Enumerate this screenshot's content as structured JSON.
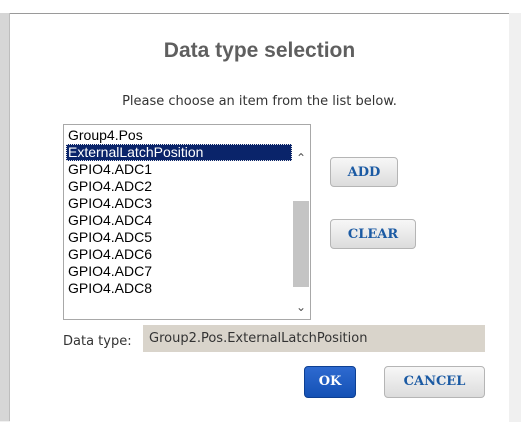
{
  "dialog": {
    "title": "Data type selection",
    "instruction": "Please choose an item from the list below."
  },
  "list": {
    "items": [
      "Group4.Pos",
      "ExternalLatchPosition",
      "GPIO4.ADC1",
      "GPIO4.ADC2",
      "GPIO4.ADC3",
      "GPIO4.ADC4",
      "GPIO4.ADC5",
      "GPIO4.ADC6",
      "GPIO4.ADC7",
      "GPIO4.ADC8"
    ],
    "selected_index": 1,
    "scroll_up_icon": "chevron-up-icon",
    "scroll_down_icon": "chevron-down-icon"
  },
  "buttons": {
    "add_label": "ADD",
    "clear_label": "CLEAR",
    "ok_label": "OK",
    "cancel_label": "CANCEL"
  },
  "data_type": {
    "label": "Data type:",
    "value": "Group2.Pos.ExternalLatchPosition"
  },
  "colors": {
    "selection": "#0a246a",
    "primary_button": "#1451b5",
    "button_text": "#1b5aa3",
    "field_background": "#d9d4cb"
  }
}
